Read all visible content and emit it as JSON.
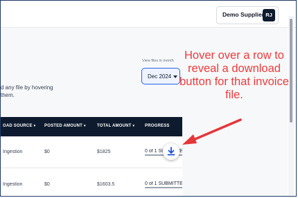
{
  "header": {
    "supplier_name": "Demo Supplier",
    "avatar_initials": "RJ"
  },
  "filters": {
    "view_files_label": "View files in month",
    "month_value": "Dec 2024"
  },
  "description": {
    "line1": "d any file by hovering",
    "line2": "them."
  },
  "table": {
    "columns": [
      "OAD SOURCE",
      "POSTED AMOUNT",
      "TOTAL AMOUNT",
      "PROGRESS"
    ],
    "rows": [
      {
        "source": "Ingestion",
        "posted": "$0",
        "total": "$1825",
        "progress": "0 of 1 SUBMITTE"
      },
      {
        "source": "Ingestion",
        "posted": "$0",
        "total": "$1603.5",
        "progress": "0 of 1 SUBMITTE"
      }
    ]
  },
  "callout": {
    "text": "Hover over a row to reveal a download button for that invoice file."
  },
  "colors": {
    "callout_red": "#ef3b3b",
    "table_header_navy": "#0e1b2e",
    "select_accent": "#2563eb"
  },
  "icons": {
    "download": "download-icon",
    "dropdown": "caret-down-icon",
    "sort": "sort-arrow-icon"
  }
}
